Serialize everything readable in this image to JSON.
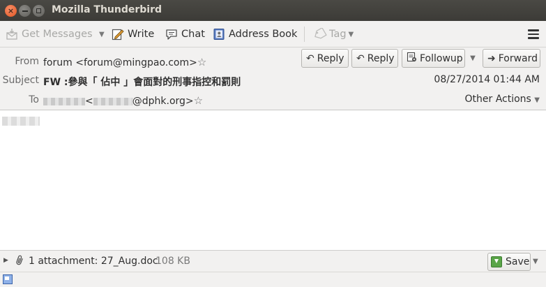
{
  "window": {
    "title": "Mozilla Thunderbird",
    "close_glyph": "×"
  },
  "toolbar": {
    "get_messages": "Get Messages",
    "write": "Write",
    "chat": "Chat",
    "address_book": "Address Book",
    "tag": "Tag"
  },
  "header": {
    "from_label": "From",
    "from_value": "forum <forum@mingpao.com>",
    "subject_label": "Subject",
    "subject_value": "FW :參與「 佔中 」會面對的刑事指控和罰則",
    "to_label": "To",
    "to_domain": "@dphk.org>",
    "to_open": "<",
    "date": "08/27/2014 01:44 AM",
    "other_actions": "Other Actions",
    "buttons": {
      "reply": "Reply",
      "reply_all": "Reply",
      "followup": "Followup",
      "forward": "Forward"
    }
  },
  "attachment": {
    "label": "1 attachment: 27_Aug.doc",
    "size": "108 KB",
    "save": "Save"
  },
  "colors": {
    "titlebar": "#3c3b37",
    "toolbar_bg": "#f2f1f0",
    "close_button": "#e2531f"
  },
  "icons": {
    "get_messages": "download-mail-icon",
    "write": "pencil-icon",
    "chat": "chat-bubble-icon",
    "address_book": "address-book-icon",
    "tag": "tag-icon",
    "menu": "hamburger-icon",
    "star": "star-icon",
    "reply": "reply-arrow-icon",
    "followup": "newsgroup-followup-icon",
    "forward": "forward-arrow-icon",
    "attachment": "paperclip-icon",
    "save": "save-download-icon",
    "status": "online-status-icon"
  }
}
